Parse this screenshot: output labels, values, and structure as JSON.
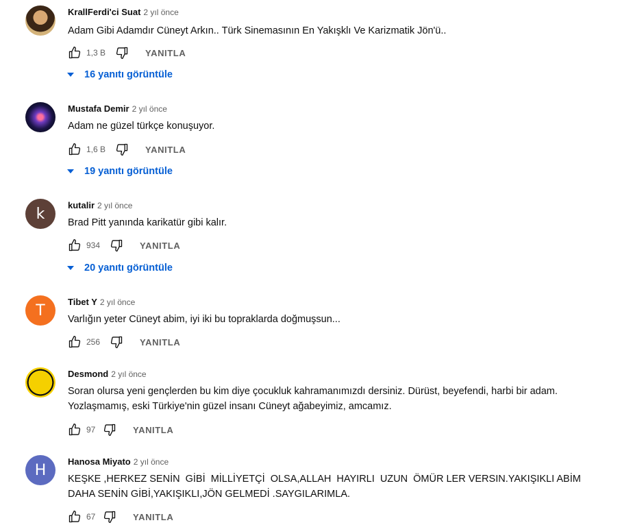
{
  "comments": [
    {
      "author": "KrallFerdi'ci Suat",
      "time": "2 yıl önce",
      "text": "Adam Gibi Adamdır Cüneyt Arkın.. Türk Sinemasının En Yakışklı Ve Karizmatik Jön'ü..",
      "likes": "1,3 B",
      "reply": "YANITLA",
      "replies": "16 yanıtı görüntüle"
    },
    {
      "author": "Mustafa Demir",
      "time": "2 yıl önce",
      "text": "Adam ne güzel türkçe konuşuyor.",
      "likes": "1,6 B",
      "reply": "YANITLA",
      "replies": "19 yanıtı görüntüle"
    },
    {
      "author": "kutalir",
      "avatar_letter": "k",
      "time": "2 yıl önce",
      "text": "Brad Pitt yanında karikatür gibi kalır.",
      "likes": "934",
      "reply": "YANITLA",
      "replies": "20 yanıtı görüntüle"
    },
    {
      "author": "Tibet Y",
      "avatar_letter": "T",
      "time": "2 yıl önce",
      "text": "Varlığın yeter Cüneyt abim, iyi iki bu topraklarda doğmuşsun...",
      "likes": "256",
      "reply": "YANITLA"
    },
    {
      "author": "Desmond",
      "time": "2 yıl önce",
      "text": "Soran olursa yeni gençlerden bu kim diye çocukluk kahramanımızdı dersiniz. Dürüst, beyefendi, harbi bir adam. Yozlaşmamış, eski Türkiye'nin güzel insanı Cüneyt ağabeyimiz, amcamız.",
      "likes": "97",
      "reply": "YANITLA"
    },
    {
      "author": "Hanosa Miyato",
      "avatar_letter": "H",
      "time": "2 yıl önce",
      "text": "KEŞKE ,HERKEZ SENİN  GİBİ  MİLLİYETÇİ  OLSA,ALLAH  HAYIRLI  UZUN  ÖMÜR LER VERSIN.YAKIŞIKLI ABİM  DAHA SENİN GİBİ,YAKIŞIKLI,JÖN GELMEDİ .SAYGILARIMLA.",
      "likes": "67",
      "reply": "YANITLA"
    }
  ],
  "colors": {
    "link": "#065fd4",
    "secondary": "#606060",
    "text": "#0f0f0f"
  },
  "icons": {
    "like": "thumb-up-outline-icon",
    "dislike": "thumb-down-outline-icon",
    "expand": "caret-down-icon"
  }
}
